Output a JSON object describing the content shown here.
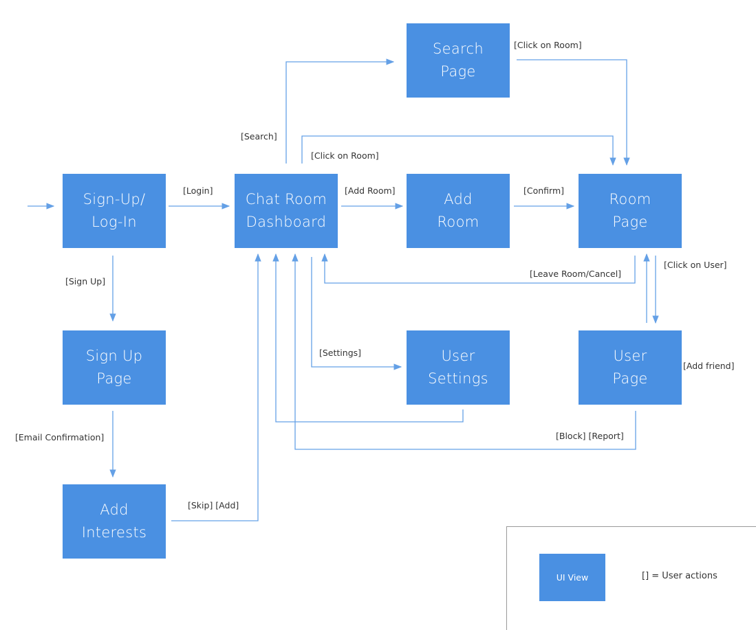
{
  "colors": {
    "node": "#4A90E2",
    "edge": "#4A90E2",
    "label": "#333333",
    "legend_border": "#999999"
  },
  "nodes": {
    "signup_login": "Sign-Up/\nLog-In",
    "dashboard": "Chat Room\nDashboard",
    "search": "Search\nPage",
    "add_room": "Add\nRoom",
    "room_page": "Room\nPage",
    "signup_page": "Sign Up\nPage",
    "add_interests": "Add\nInterests",
    "user_settings": "User\nSettings",
    "user_page": "User\nPage"
  },
  "edges": [
    {
      "from": "start",
      "to": "signup_login",
      "label": ""
    },
    {
      "from": "signup_login",
      "to": "dashboard",
      "label": "[Login]"
    },
    {
      "from": "signup_login",
      "to": "signup_page",
      "label": "[Sign Up]"
    },
    {
      "from": "signup_page",
      "to": "add_interests",
      "label": "[Email Confirmation]"
    },
    {
      "from": "add_interests",
      "to": "dashboard",
      "label": "[Skip] [Add]"
    },
    {
      "from": "dashboard",
      "to": "search",
      "label": "[Search]"
    },
    {
      "from": "search",
      "to": "room_page",
      "label": "[Click on Room]"
    },
    {
      "from": "dashboard",
      "to": "room_page",
      "label": "[Click on Room]"
    },
    {
      "from": "dashboard",
      "to": "add_room",
      "label": "[Add Room]"
    },
    {
      "from": "add_room",
      "to": "room_page",
      "label": "[Confirm]"
    },
    {
      "from": "room_page",
      "to": "dashboard",
      "label": "[Leave Room/Cancel]"
    },
    {
      "from": "room_page",
      "to": "user_page",
      "label": "[Click on User]"
    },
    {
      "from": "user_page",
      "to": "room_page",
      "label": ""
    },
    {
      "from": "dashboard",
      "to": "user_settings",
      "label": "[Settings]"
    },
    {
      "from": "user_settings",
      "to": "dashboard",
      "label": ""
    },
    {
      "from": "user_page",
      "to": "dashboard",
      "label": "[Block] [Report]"
    },
    {
      "from": "user_page",
      "to": "user_page",
      "label": "[Add friend]"
    }
  ],
  "legend": {
    "node_label": "UI View",
    "text": "[] = User actions"
  }
}
